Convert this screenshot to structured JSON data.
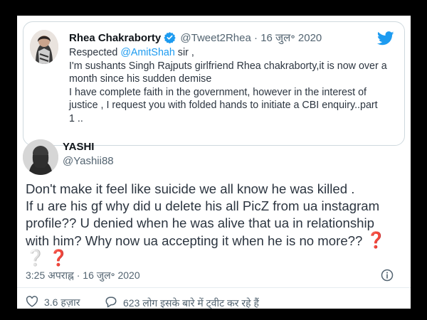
{
  "quoted_tweet": {
    "name": "Rhea Chakraborty",
    "handle": "@Tweet2Rhea",
    "separator": "·",
    "date": "16 जुल॰ 2020",
    "greeting_before": "Respected ",
    "mention": "@AmitShah",
    "greeting_after": " sir ,",
    "lines": [
      "I'm sushants Singh Rajputs girlfriend Rhea chakraborty,it is now over a",
      "month since his sudden demise",
      "I have complete faith in the government, however in the interest of",
      "justice , I request you with folded hands to initiate a CBI enquiry..part",
      "1 .."
    ]
  },
  "reply_tweet": {
    "name": "YASHI",
    "handle": "@Yashii88",
    "lines": [
      "Don't make it feel like suicide we all know he was killed .",
      "If u are his gf why did u delete his all PicZ from ua instagram",
      "profile?? U denied when he was alive that ua in relationship",
      "with him? Why now ua accepting it when he is no more??"
    ],
    "emoji": [
      "❓",
      "❔",
      "❓"
    ],
    "timestamp": "3:25 अपराह्न · 16 जुल॰ 2020",
    "likes": "3.6 हज़ार",
    "talking": "623 लोग इसके बारे में ट्वीट कर रहे हैं"
  },
  "colors": {
    "accent": "#1d9bf0",
    "text": "#2c3540",
    "muted": "#536471",
    "red_emoji": "#d62839"
  },
  "icons": [
    "verified-badge-icon",
    "twitter-bird-icon",
    "info-icon",
    "heart-icon",
    "comment-icon"
  ]
}
